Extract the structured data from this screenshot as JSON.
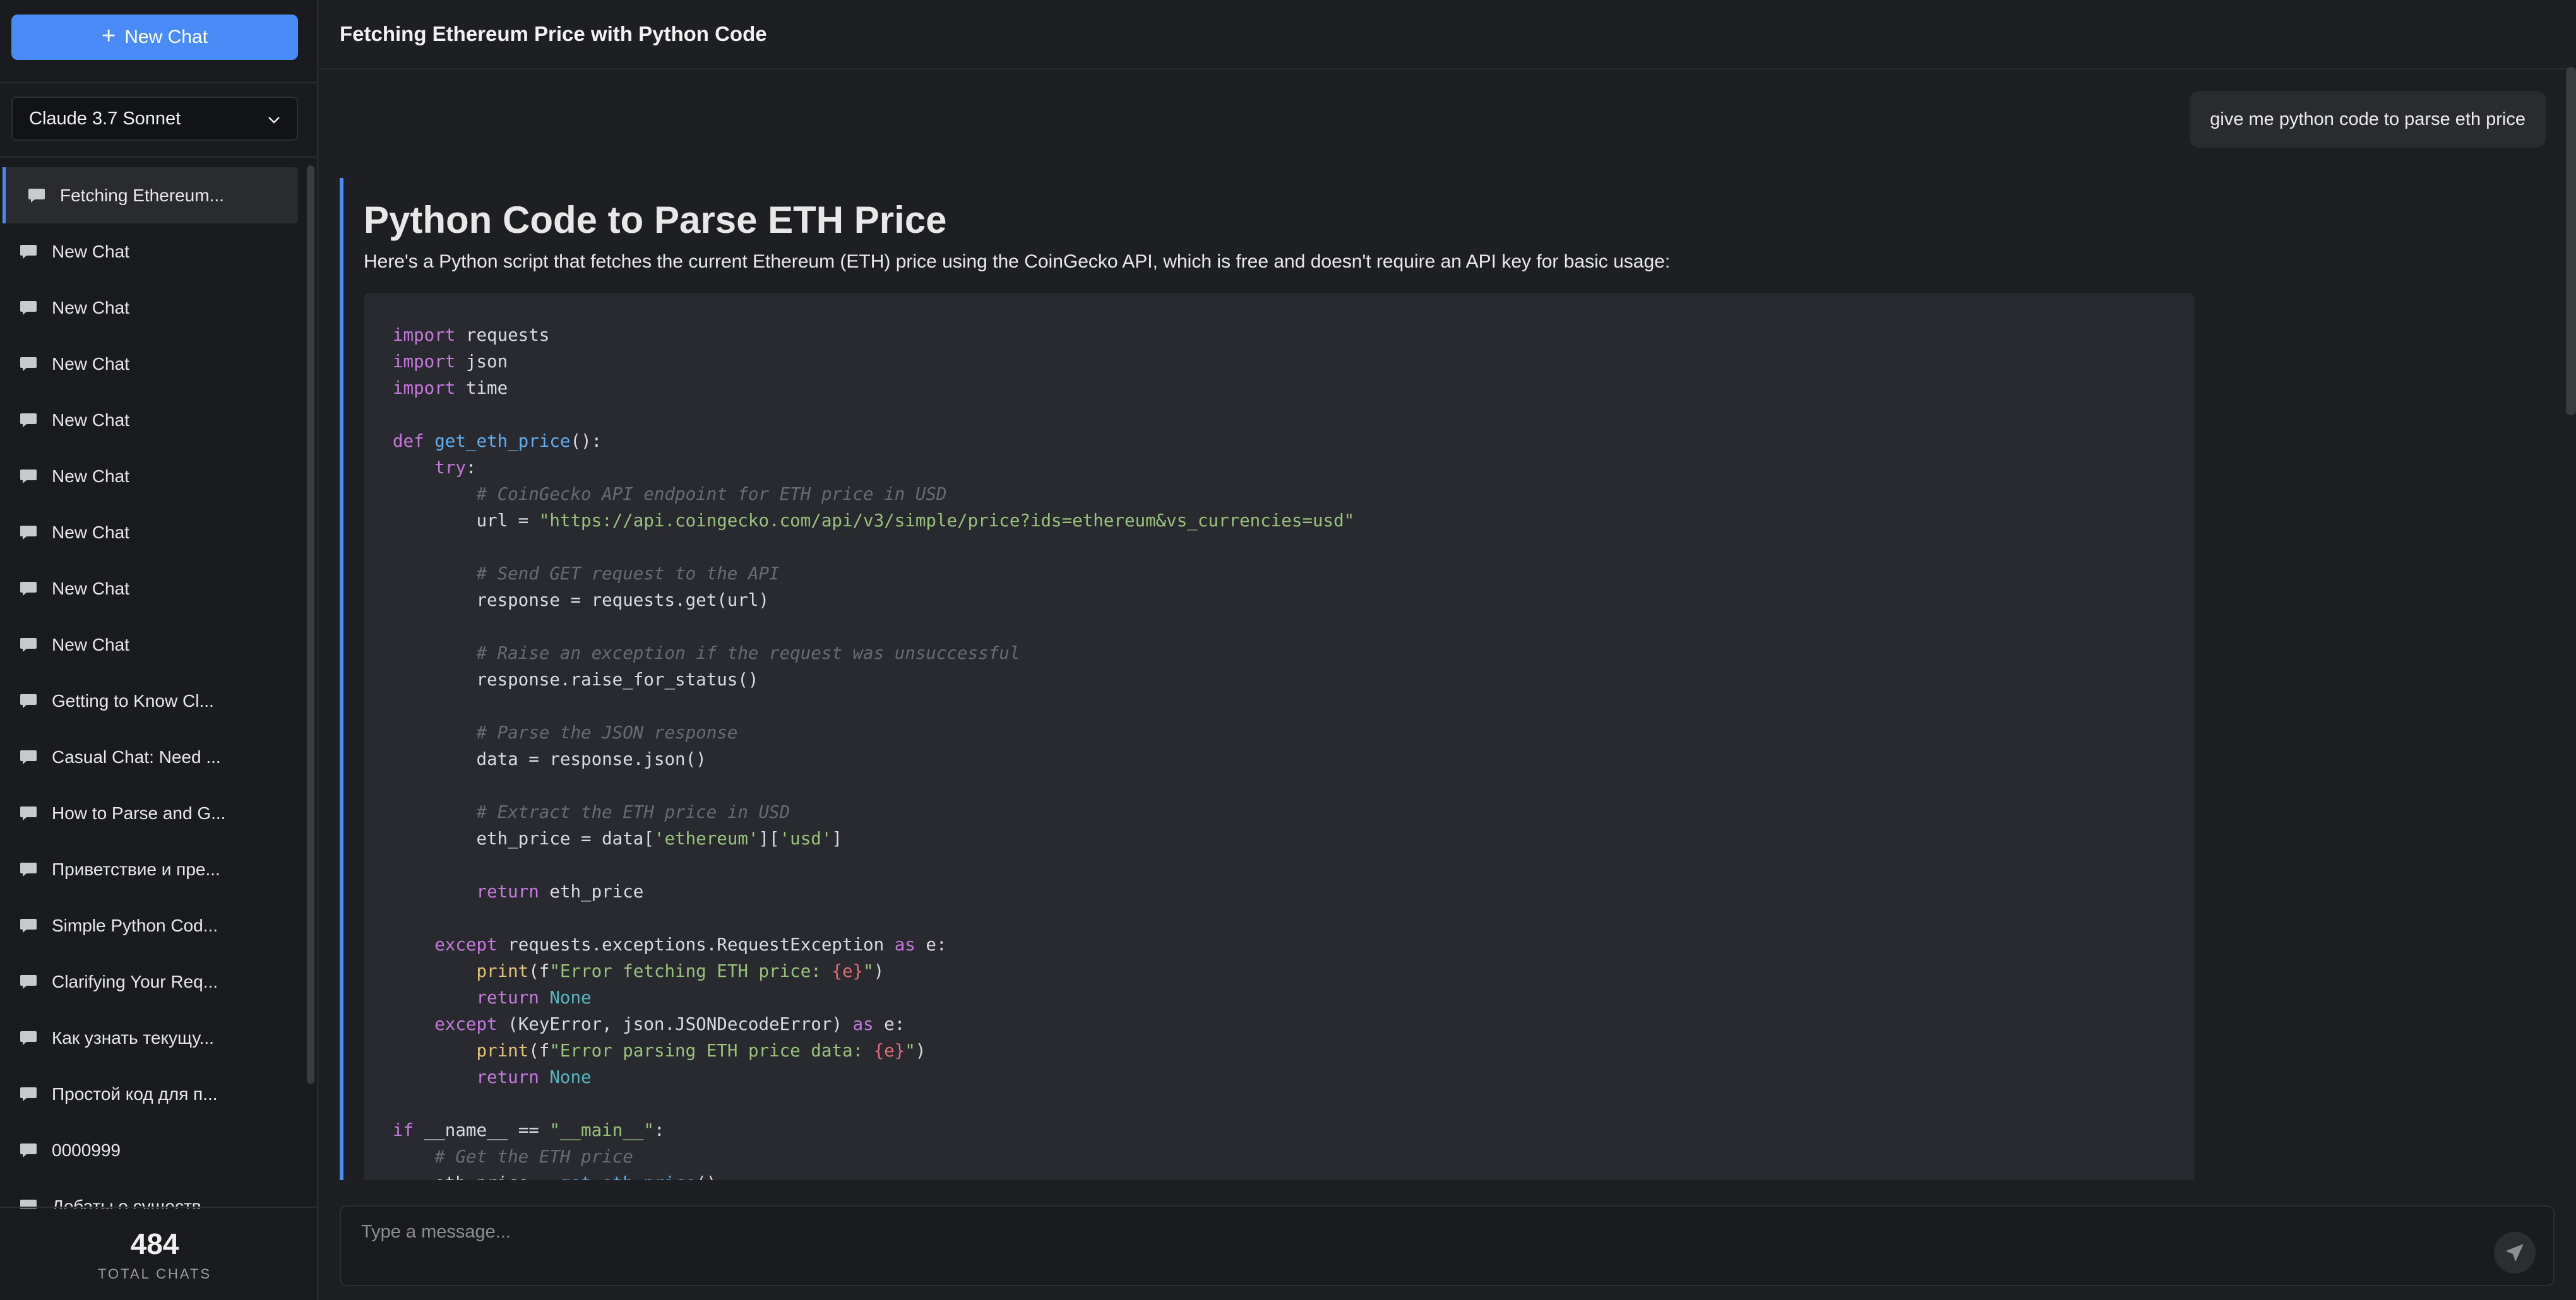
{
  "sidebar": {
    "new_chat_label": "New Chat",
    "model_selected": "Claude 3.7 Sonnet",
    "chats": [
      {
        "label": "Fetching Ethereum...",
        "active": true
      },
      {
        "label": "New Chat"
      },
      {
        "label": "New Chat"
      },
      {
        "label": "New Chat"
      },
      {
        "label": "New Chat"
      },
      {
        "label": "New Chat"
      },
      {
        "label": "New Chat"
      },
      {
        "label": "New Chat"
      },
      {
        "label": "New Chat"
      },
      {
        "label": "Getting to Know Cl..."
      },
      {
        "label": "Casual Chat: Need ..."
      },
      {
        "label": "How to Parse and G..."
      },
      {
        "label": "Приветствие и пре..."
      },
      {
        "label": "Simple Python Cod..."
      },
      {
        "label": "Clarifying Your Req..."
      },
      {
        "label": "Как узнать текущу..."
      },
      {
        "label": "Простой код для п..."
      },
      {
        "label": "0000999"
      },
      {
        "label": "Дебаты о существ..."
      }
    ],
    "total_count": "484",
    "total_label": "TOTAL CHATS"
  },
  "header": {
    "title": "Fetching Ethereum Price with Python Code"
  },
  "conversation": {
    "user_message": "give me python code to parse eth price",
    "assistant": {
      "heading": "Python Code to Parse ETH Price",
      "intro": "Here's a Python script that fetches the current Ethereum (ETH) price using the CoinGecko API, which is free and doesn't require an API key for basic usage:",
      "code_language": "python",
      "code_lines": [
        "import requests",
        "import json",
        "import time",
        "",
        "def get_eth_price():",
        "    try:",
        "        # CoinGecko API endpoint for ETH price in USD",
        "        url = \"https://api.coingecko.com/api/v3/simple/price?ids=ethereum&vs_currencies=usd\"",
        "",
        "        # Send GET request to the API",
        "        response = requests.get(url)",
        "",
        "        # Raise an exception if the request was unsuccessful",
        "        response.raise_for_status()",
        "",
        "        # Parse the JSON response",
        "        data = response.json()",
        "",
        "        # Extract the ETH price in USD",
        "        eth_price = data['ethereum']['usd']",
        "",
        "        return eth_price",
        "",
        "    except requests.exceptions.RequestException as e:",
        "        print(f\"Error fetching ETH price: {e}\")",
        "        return None",
        "    except (KeyError, json.JSONDecodeError) as e:",
        "        print(f\"Error parsing ETH price data: {e}\")",
        "        return None",
        "",
        "if __name__ == \"__main__\":",
        "    # Get the ETH price",
        "    eth_price = get_eth_price()"
      ]
    }
  },
  "composer": {
    "placeholder": "Type a message..."
  },
  "colors": {
    "accent": "#4a8cf7",
    "background": "#1e1f23",
    "sidebar": "#1a1b1e",
    "code_bg": "#282a30"
  },
  "icons": {
    "new_chat": "plus-icon",
    "chat_item": "chat-bubble-icon",
    "model_select": "chevron-down-icon",
    "send": "send-icon"
  }
}
